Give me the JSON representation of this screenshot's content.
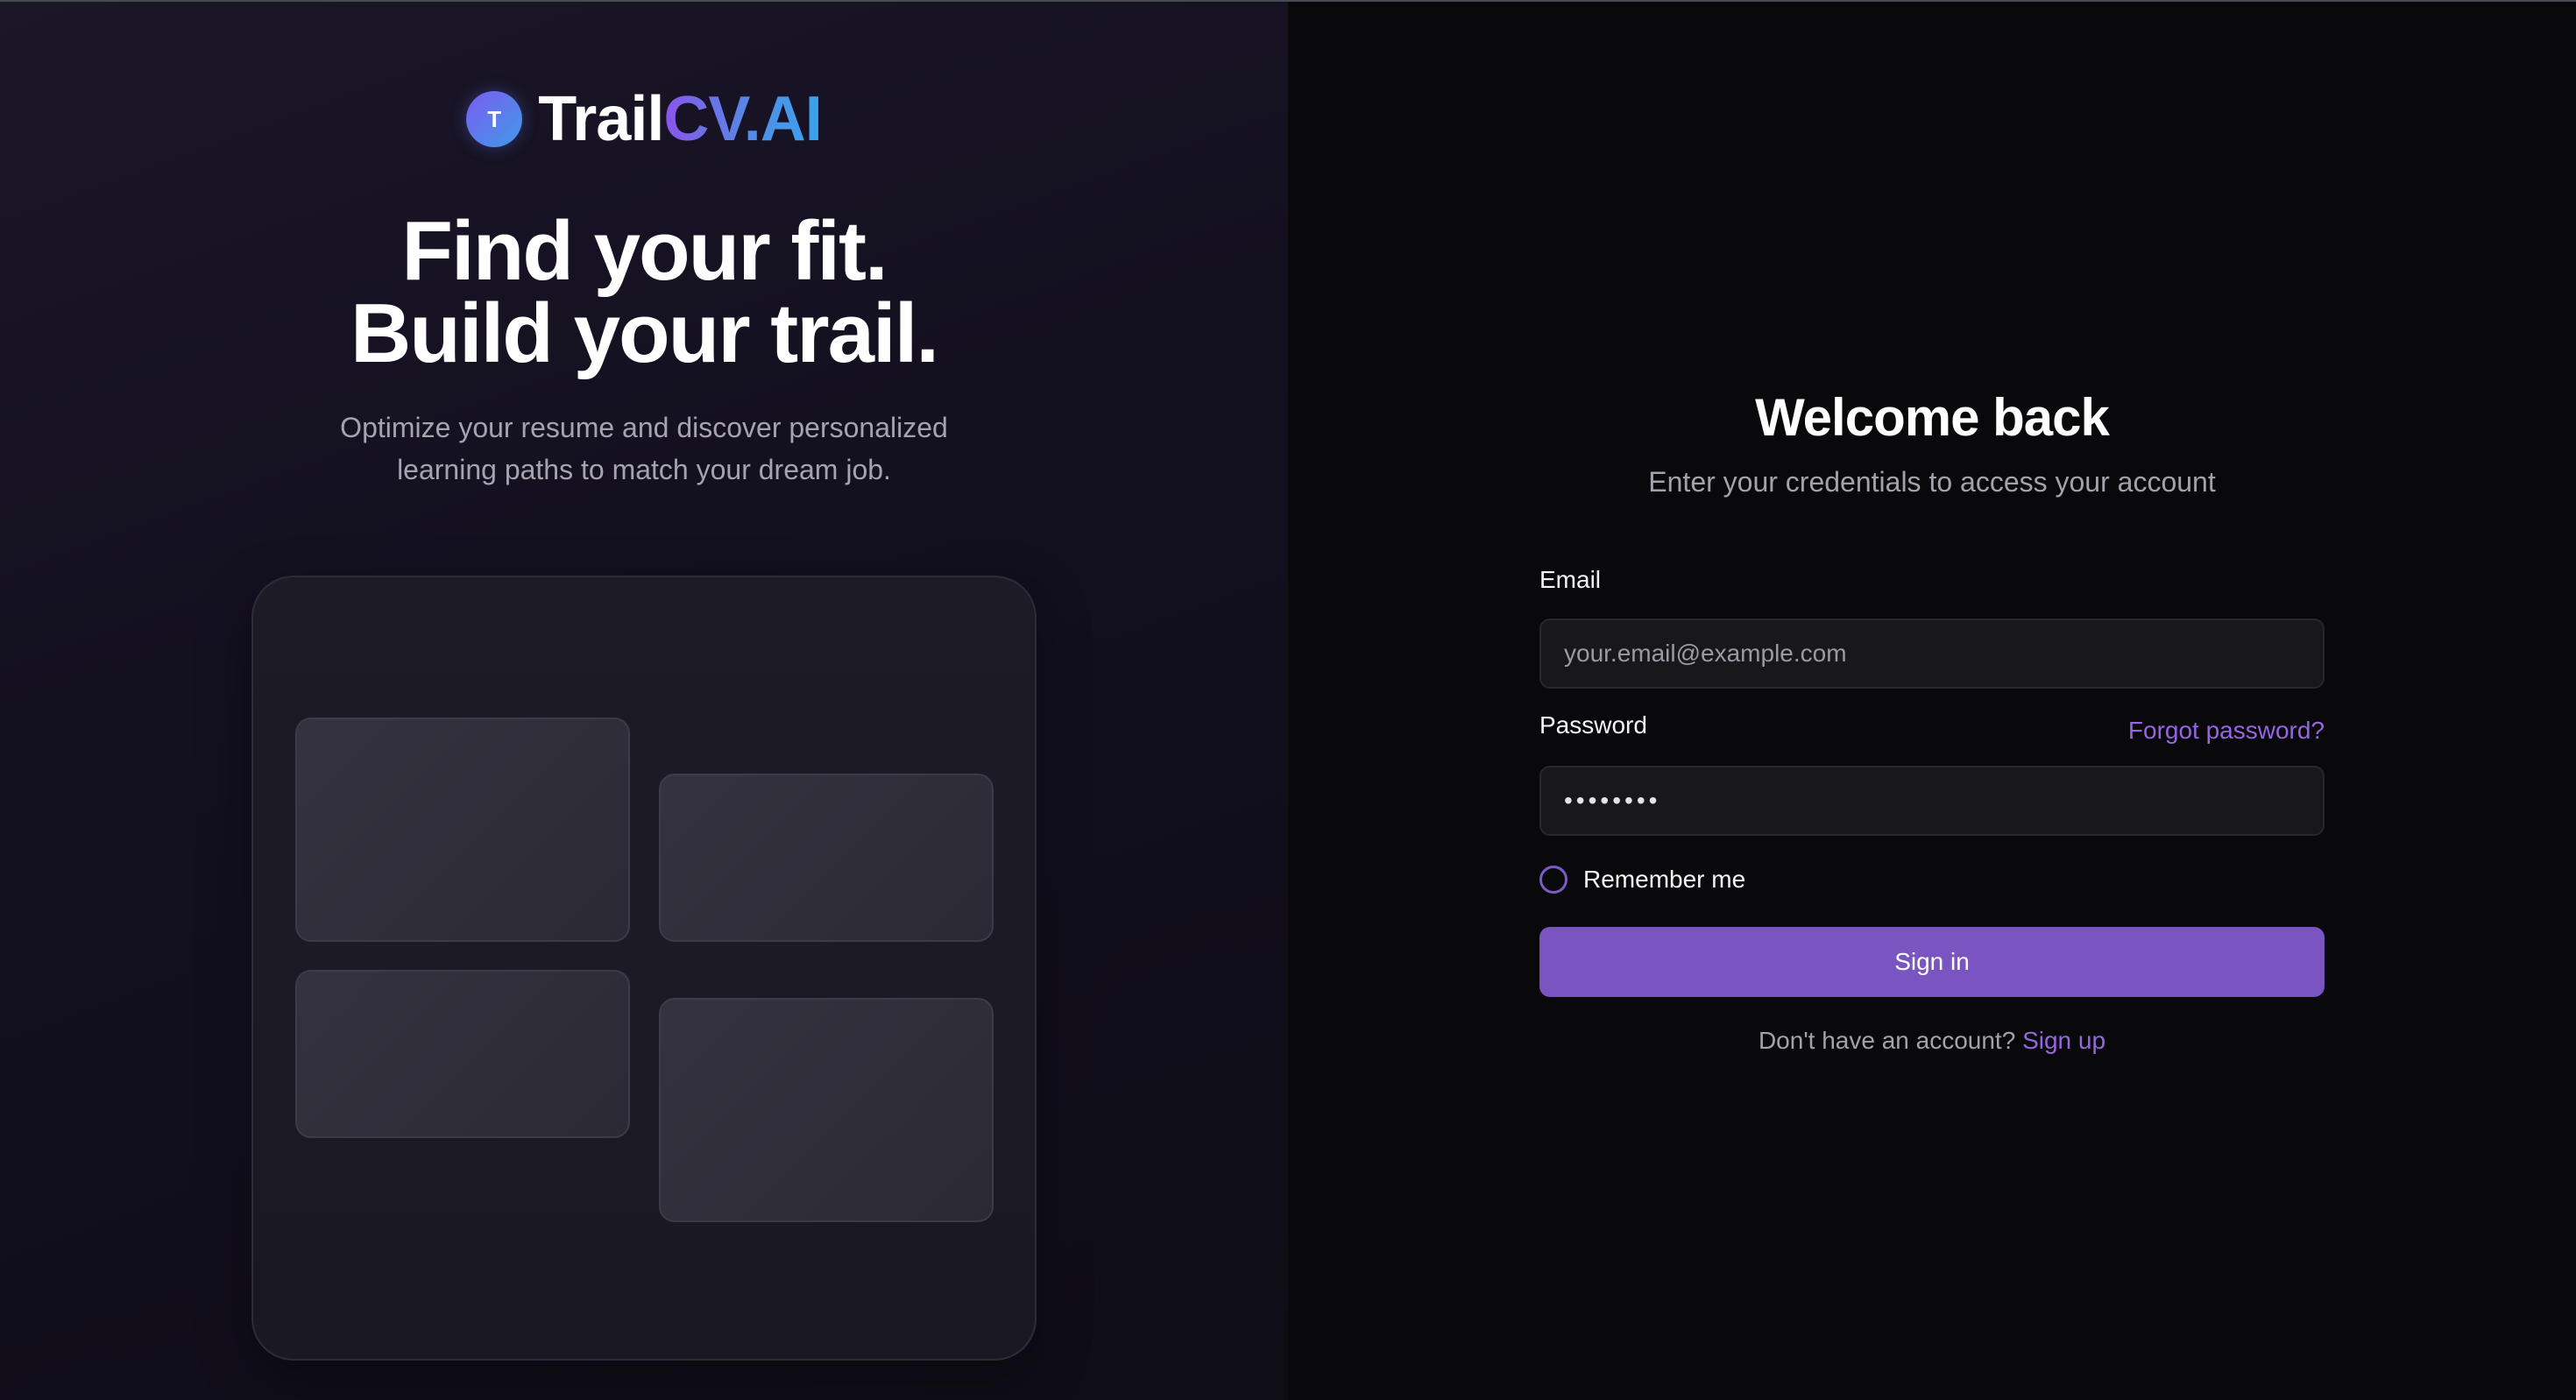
{
  "brand": {
    "badge_letter": "T",
    "name_part1": "Trail",
    "name_part2": "CV.AI"
  },
  "hero": {
    "headline_line1": "Find your fit.",
    "headline_line2": "Build your trail.",
    "tagline_line1": "Optimize your resume and discover personalized",
    "tagline_line2": "learning paths to match your dream job."
  },
  "login": {
    "title": "Welcome back",
    "subtitle": "Enter your credentials to access your account",
    "email_label": "Email",
    "email_placeholder": "your.email@example.com",
    "password_label": "Password",
    "password_value": "••••••••",
    "forgot_label": "Forgot password?",
    "remember_label": "Remember me",
    "remember_checked": false,
    "signin_label": "Sign in",
    "signup_prompt": "Don't have an account?",
    "signup_link": "Sign up"
  },
  "colors": {
    "accent": "#7a55c2",
    "link": "#9466e0",
    "background": "#09090b"
  }
}
